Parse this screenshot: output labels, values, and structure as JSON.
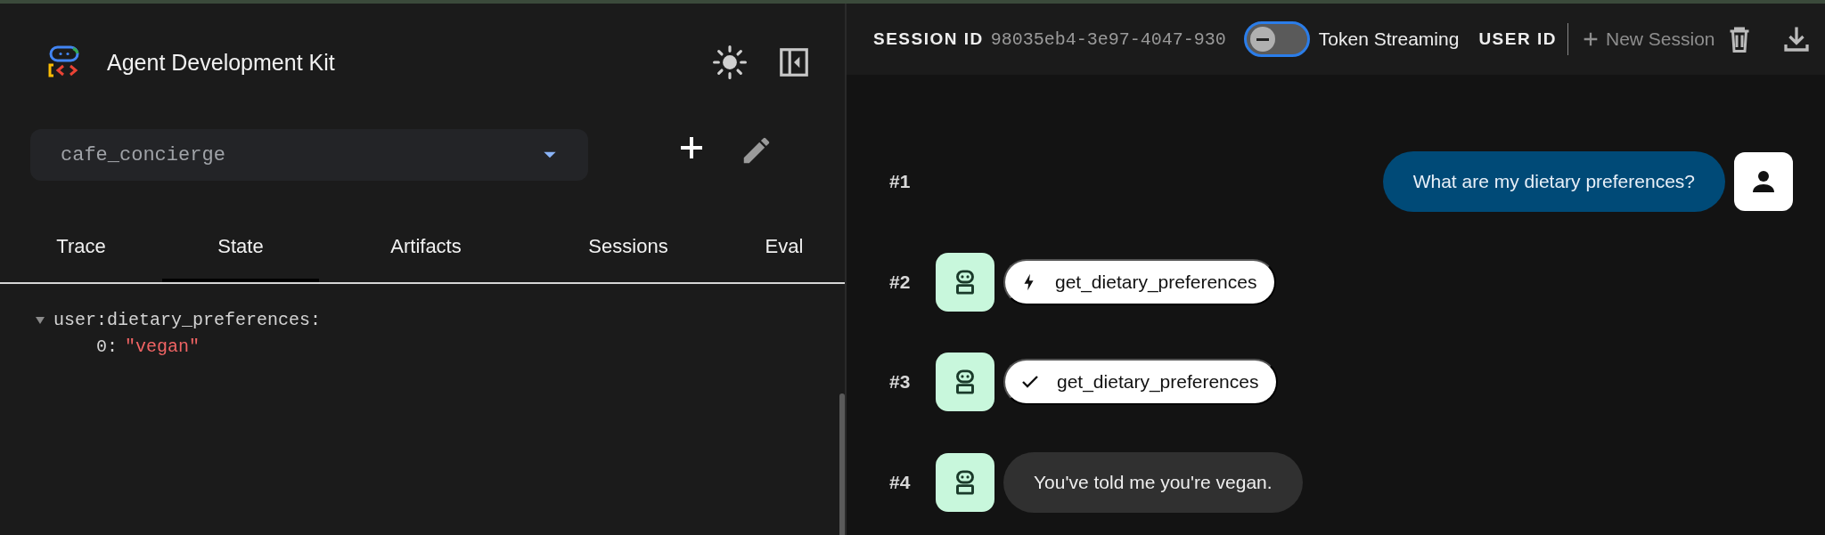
{
  "sidebar": {
    "title": "Agent Development Kit",
    "app_select": {
      "value": "cafe_concierge"
    },
    "tabs": [
      {
        "label": "Trace",
        "selected": false
      },
      {
        "label": "State",
        "selected": true
      },
      {
        "label": "Artifacts",
        "selected": false
      },
      {
        "label": "Sessions",
        "selected": false
      },
      {
        "label": "Eval",
        "selected": false
      }
    ],
    "state_tree": [
      {
        "key": "user:dietary_preferences:",
        "expanded": true,
        "children": [
          {
            "key": "0:",
            "value": "\"vegan\""
          }
        ]
      }
    ]
  },
  "header": {
    "session_label": "SESSION ID",
    "session_id": "98035eb4-3e97-4047-930",
    "token_streaming": {
      "label": "Token Streaming",
      "on": false
    },
    "user_label": "USER ID",
    "new_session": "New Session"
  },
  "messages": [
    {
      "index": "#1",
      "kind": "user_text",
      "text": "What are my dietary preferences?"
    },
    {
      "index": "#2",
      "kind": "function_call",
      "text": "get_dietary_preferences"
    },
    {
      "index": "#3",
      "kind": "function_response",
      "text": "get_dietary_preferences"
    },
    {
      "index": "#4",
      "kind": "agent_text",
      "text": "You've told me you're vegan."
    }
  ]
}
